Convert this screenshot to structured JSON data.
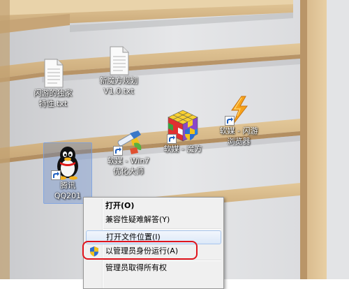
{
  "desktop": {
    "icons": [
      {
        "label_1": "闪游的独家",
        "label_2": "特性.txt",
        "icon": "text-file-icon"
      },
      {
        "label_1": "新魔方规划",
        "label_2": "V1.0.txt",
        "icon": "text-file-icon"
      },
      {
        "label_1": "软媒 - Win7",
        "label_2": "优化大师",
        "icon": "win7-optimizer-icon"
      },
      {
        "label_1": "软媒 - 魔方",
        "label_2": "",
        "icon": "rubiks-cube-icon"
      },
      {
        "label_1": "软媒 - 闪游",
        "label_2": "浏览器",
        "icon": "lightning-browser-icon"
      },
      {
        "label_1": "腾讯",
        "label_2": "QQ201",
        "icon": "qq-penguin-icon"
      }
    ]
  },
  "context_menu": {
    "items": [
      {
        "label": "打开(O)"
      },
      {
        "label": "兼容性疑难解答(Y)"
      },
      {
        "label": "打开文件位置(I)"
      },
      {
        "label": "以管理员身份运行(A)"
      },
      {
        "label": "管理员取得所有权"
      }
    ]
  },
  "colors": {
    "shelf_wood": "#d9bc8c",
    "back_panel": "#e4e5e7",
    "highlight_ring": "#e0141c",
    "menu_bg": "#f0f0f0"
  }
}
